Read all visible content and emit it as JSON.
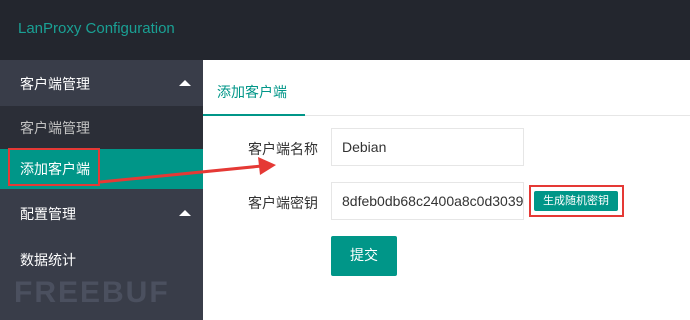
{
  "app": {
    "title": "LanProxy Configuration"
  },
  "sidebar": {
    "groups": [
      {
        "label": "客户端管理"
      },
      {
        "label": "配置管理"
      },
      {
        "label": "数据统计"
      }
    ],
    "sub_items": [
      {
        "label": "客户端管理"
      },
      {
        "label": "添加客户端"
      }
    ]
  },
  "watermark": {
    "text": "FREEBUF"
  },
  "tabs": [
    {
      "label": "添加客户端"
    }
  ],
  "form": {
    "name_label": "客户端名称",
    "name_value": "Debian",
    "secret_label": "客户端密钥",
    "secret_value": "8dfeb0db68c2400a8c0d3039",
    "generate_label": "生成随机密钥",
    "submit_label": "提交"
  },
  "colors": {
    "accent": "#009688",
    "topbar": "#23262e",
    "sidebar": "#393d49",
    "annotation": "#e53935"
  }
}
